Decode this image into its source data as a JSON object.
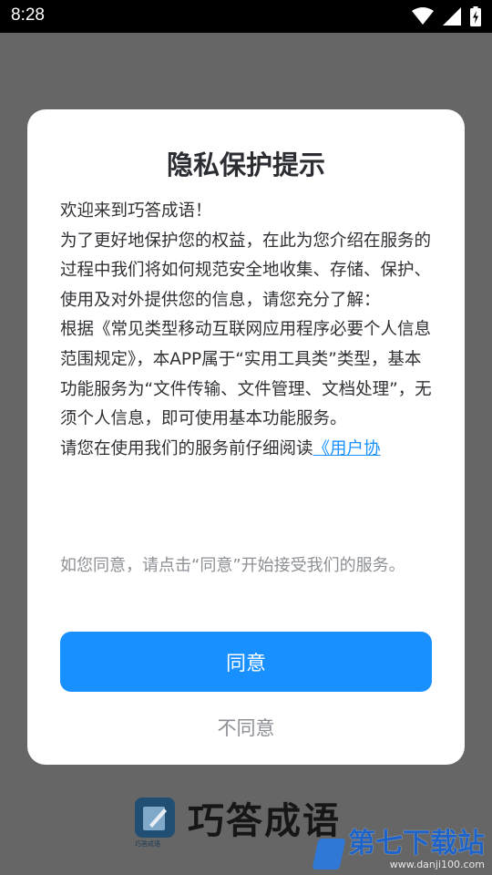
{
  "status_bar": {
    "time": "8:28",
    "icons": [
      "wifi-icon",
      "cellular-signal-icon",
      "battery-charging-icon"
    ]
  },
  "dialog": {
    "title": "隐私保护提示",
    "paragraphs": [
      "欢迎来到巧答成语！",
      "为了更好地保护您的权益，在此为您介绍在服务的过程中我们将如何规范安全地收集、存储、保护、使用及对外提供您的信息，请您充分了解：",
      "根据《常见类型移动互联网应用程序必要个人信息范围规定》，本APP属于“实用工具类”类型，基本功能服务为“文件传输、文件管理、文档处理”，无须个人信息，即可使用基本功能服务。"
    ],
    "read_prefix": "请您在使用我们的服务前仔细阅读",
    "user_agreement_link": "《用户协",
    "consent_note": "如您同意，请点击“同意”开始接受我们的服务。",
    "agree_label": "同意",
    "disagree_label": "不同意"
  },
  "app": {
    "name": "巧答成语",
    "logo_subtext": "巧答成语"
  },
  "watermark": {
    "title": "第七下载站",
    "url": "www.danji100.com"
  },
  "colors": {
    "accent": "#1890ff",
    "overlay": "#666666",
    "status_bar": "#000000",
    "title_text": "#2b2d33",
    "body_text": "#2f3134",
    "muted_text": "#8c8f94"
  }
}
